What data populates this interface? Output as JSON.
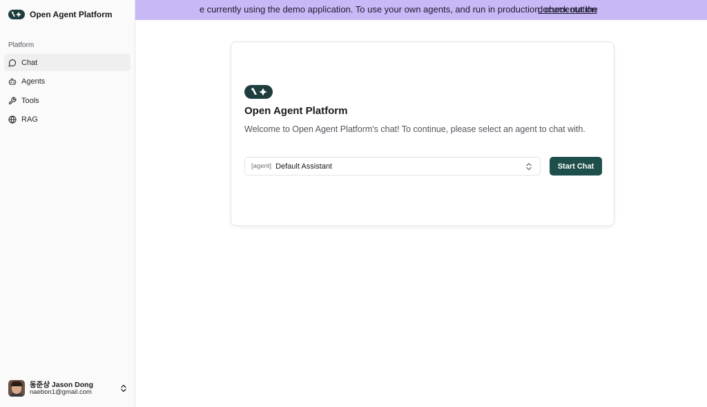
{
  "sidebar": {
    "brand": {
      "name": "Open Agent Platform",
      "icon": "agent-logo-icon"
    },
    "section_label": "Platform",
    "items": [
      {
        "label": "Chat",
        "icon": "message-circle-icon",
        "active": true
      },
      {
        "label": "Agents",
        "icon": "bot-icon",
        "active": false
      },
      {
        "label": "Tools",
        "icon": "wrench-icon",
        "active": false
      },
      {
        "label": "RAG",
        "icon": "globe-icon",
        "active": false
      }
    ],
    "user": {
      "name": "동준상 Jason Dong",
      "email": "naebon1@gmail.com"
    }
  },
  "banner": {
    "text": "e currently using the demo application. To use your own agents, and run in production, check out the",
    "link_label": "documentation",
    "color": "#c8b8f5"
  },
  "card": {
    "title": "Open Agent Platform",
    "description": "Welcome to Open Agent Platform's chat! To continue, please select an agent to chat with.",
    "select": {
      "prefix": "[agent]",
      "value": "Default Assistant"
    },
    "start_button": "Start Chat"
  },
  "colors": {
    "accent": "#1f4f4b",
    "logo": "#1f3d3d",
    "sidebar_bg": "#fafafa"
  }
}
